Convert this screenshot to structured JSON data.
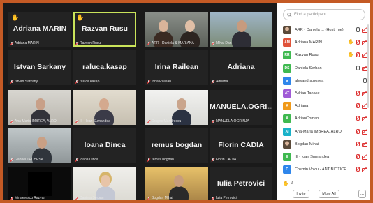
{
  "gallery": {
    "tiles": [
      {
        "big": "Adriana MARIN",
        "caption": "Adriana MARIN",
        "hand": true
      },
      {
        "big": "Razvan Rusu",
        "caption": "Razvan Rusu",
        "hand": true,
        "active": true
      },
      {
        "big": "",
        "caption": "ARR - Daniela & MARIANA",
        "video": "two-women"
      },
      {
        "big": "",
        "caption": "Mihai Dan",
        "video": "man-outdoor"
      },
      {
        "big": "Istvan Sarkany",
        "caption": "Istvan Sarkany"
      },
      {
        "big": "raluca.kasap",
        "caption": "raluca.kasap"
      },
      {
        "big": "Irina Railean",
        "caption": "Irina Railean"
      },
      {
        "big": "Adriana",
        "caption": "Adriana"
      },
      {
        "big": "",
        "caption": "Ana-Maria IMBREA, ALRO",
        "video": "man-office"
      },
      {
        "big": "",
        "caption": "III - Ioan Sumandea",
        "video": "man-glasses"
      },
      {
        "big": "",
        "caption": "Dragos Mandrescu",
        "video": "man-room"
      },
      {
        "big": "MANUELA.OGRI...",
        "caption": "MANUELA.OGRINJA"
      },
      {
        "big": "",
        "caption": "Gabriel TECHESA",
        "video": "man-desk"
      },
      {
        "big": "Ioana Dinca",
        "caption": "Ioana Dinca"
      },
      {
        "big": "remus bogdan",
        "caption": "remus bogdan"
      },
      {
        "big": "Florin CADIA",
        "caption": "Florin CADIA"
      },
      {
        "big": "",
        "caption": "Minaerescu Razvan",
        "video": "dark"
      },
      {
        "big": "",
        "caption": "Daniela Serban",
        "video": "woman-blonde"
      },
      {
        "big": "",
        "caption": "Bogdan Mihai",
        "video": "man-bright"
      },
      {
        "big": "Iulia Petrovici",
        "caption": "Iulia Petrovici"
      }
    ]
  },
  "panel": {
    "search_placeholder": "Find a participant",
    "participants": [
      {
        "initials": "",
        "name": "ARR - Daniela ... (Host, me)",
        "color": "#e0e0e0",
        "photo": true,
        "icons": [
          "mic-on",
          "cam-m"
        ]
      },
      {
        "initials": "AM",
        "name": "Adriana MARIN",
        "color": "#e0533a",
        "icons": [
          "hand",
          "mic-m",
          "cam-m"
        ]
      },
      {
        "initials": "RR",
        "name": "Razvan Rusu",
        "color": "#3fb950",
        "icons": [
          "hand",
          "mic-m",
          "cam-m"
        ]
      },
      {
        "initials": "DS",
        "name": "Daniela Serban",
        "color": "#3fb950",
        "icons": [
          "mic-on",
          "cam-m"
        ]
      },
      {
        "initials": "a",
        "name": "alexandra.posea",
        "color": "#2f86eb",
        "icons": [
          "mic-on"
        ]
      },
      {
        "initials": "AT",
        "name": "Adrian Tanase",
        "color": "#a05ad6",
        "icons": [
          "mic-m",
          "cam-m"
        ]
      },
      {
        "initials": "A",
        "name": "Adriana",
        "color": "#f09a1a",
        "icons": [
          "mic-m",
          "cam-m"
        ]
      },
      {
        "initials": "A",
        "name": "AdrianComan",
        "color": "#3fb950",
        "icons": [
          "mic-m",
          "cam-m"
        ]
      },
      {
        "initials": "AI",
        "name": "Ana-Maria IMBREA, ALRO",
        "color": "#1ab2c9",
        "icons": [
          "mic-m",
          "cam-m"
        ]
      },
      {
        "initials": "",
        "name": "Bogdan Mihai",
        "color": "#c08a4a",
        "photo": true,
        "icons": [
          "mic-m",
          "cam-m"
        ]
      },
      {
        "initials": "II",
        "name": "III - Ioan Sumandea",
        "color": "#3fb950",
        "icons": [
          "mic-m",
          "cam-m"
        ]
      },
      {
        "initials": "C",
        "name": "Cosmin Voicu - ANTIBIOTICE",
        "color": "#2f86eb",
        "icons": [
          "mic-m",
          "cam-m"
        ]
      }
    ],
    "raised_hands": "2",
    "invite_label": "Invite",
    "mute_all_label": "Mute All",
    "more_label": "..."
  }
}
